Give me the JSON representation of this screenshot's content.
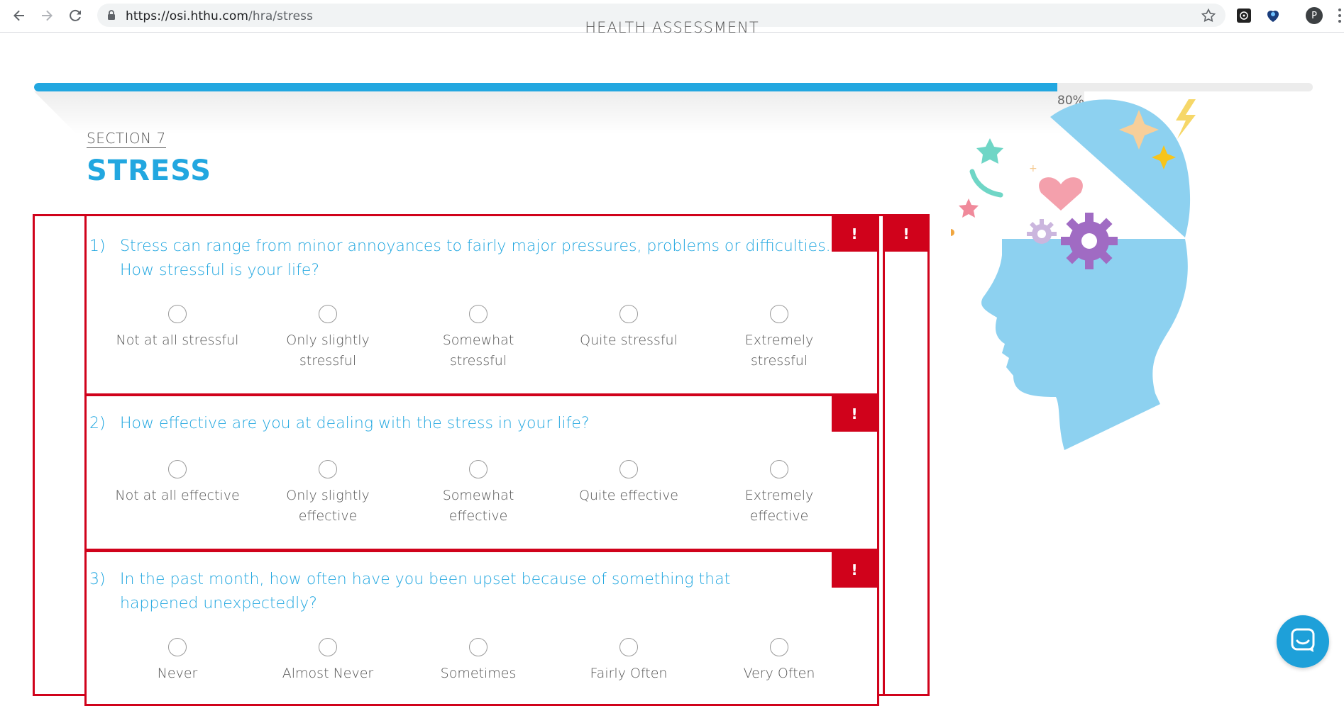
{
  "browser": {
    "url_host": "https://osi.hthu.com",
    "url_path": "/hra/stress",
    "profile_initial": "P"
  },
  "page": {
    "header_title": "HEALTH ASSESSMENT",
    "progress_percent": 0.8,
    "progress_label": "80%",
    "section_label": "SECTION 7",
    "section_title": "STRESS",
    "error_flag": "!"
  },
  "questions": [
    {
      "number": "1)",
      "text": "Stress can range from minor annoyances to fairly major pressures, problems or difficulties. How stressful is your life?",
      "options": [
        "Not at all stressful",
        "Only slightly stressful",
        "Somewhat stressful",
        "Quite stressful",
        "Extremely stressful"
      ]
    },
    {
      "number": "2)",
      "text": "How effective are you at dealing with the stress in your life?",
      "options": [
        "Not at all effective",
        "Only slightly effective",
        "Somewhat effective",
        "Quite effective",
        "Extremely effective"
      ]
    },
    {
      "number": "3)",
      "text": "In the past month, how often have you been upset because of something that happened unexpectedly?",
      "options": [
        "Never",
        "Almost Never",
        "Sometimes",
        "Fairly Often",
        "Very Often"
      ]
    }
  ],
  "colors": {
    "accent": "#22a7e0",
    "error": "#d0021b",
    "illustration_head": "#8dd1f0"
  },
  "icons": [
    "back-icon",
    "forward-icon",
    "reload-icon",
    "lock-icon",
    "bookmark-star-icon",
    "chat-icon"
  ]
}
